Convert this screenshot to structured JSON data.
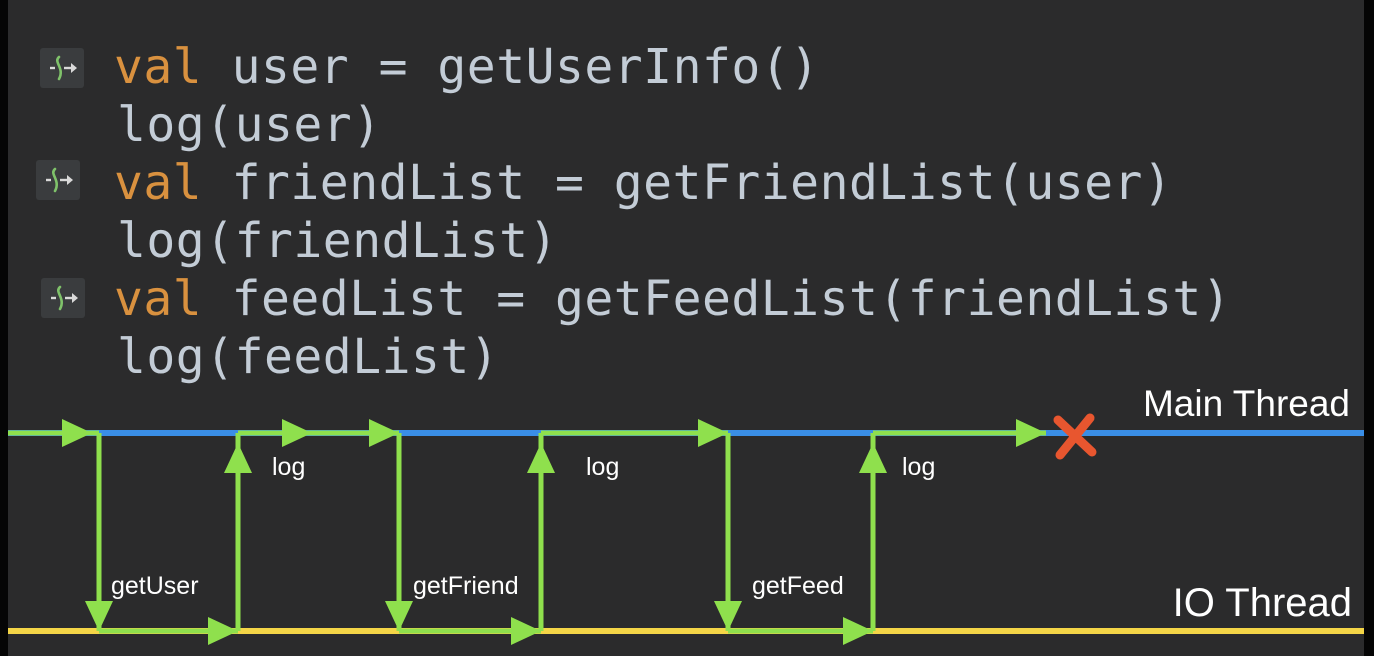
{
  "code": {
    "lines": [
      {
        "has_icon": true,
        "keyword": "val",
        "text": " user = getUserInfo()"
      },
      {
        "has_icon": false,
        "keyword": "",
        "text": "log(user)"
      },
      {
        "has_icon": true,
        "keyword": "val",
        "text": " friendList = getFriendList(user)"
      },
      {
        "has_icon": false,
        "keyword": "",
        "text": "log(friendList)"
      },
      {
        "has_icon": true,
        "keyword": "val",
        "text": " feedList = getFeedList(friendList)"
      },
      {
        "has_icon": false,
        "keyword": "",
        "text": "log(feedList)"
      }
    ],
    "gutter_icon": "suspend-function-icon"
  },
  "diagram": {
    "main_thread_label": "Main Thread",
    "io_thread_label": "IO Thread",
    "io_labels": [
      "getUser",
      "getFriend",
      "getFeed"
    ],
    "main_labels": [
      "log",
      "log",
      "log"
    ],
    "end_marker": "cross-icon",
    "colors": {
      "main_thread": "#3a8ee6",
      "io_thread": "#f4d547",
      "flow": "#8fe04d",
      "cross": "#e8562f",
      "code_keyword": "#d9913f",
      "code_text": "#c3ccd6"
    }
  }
}
